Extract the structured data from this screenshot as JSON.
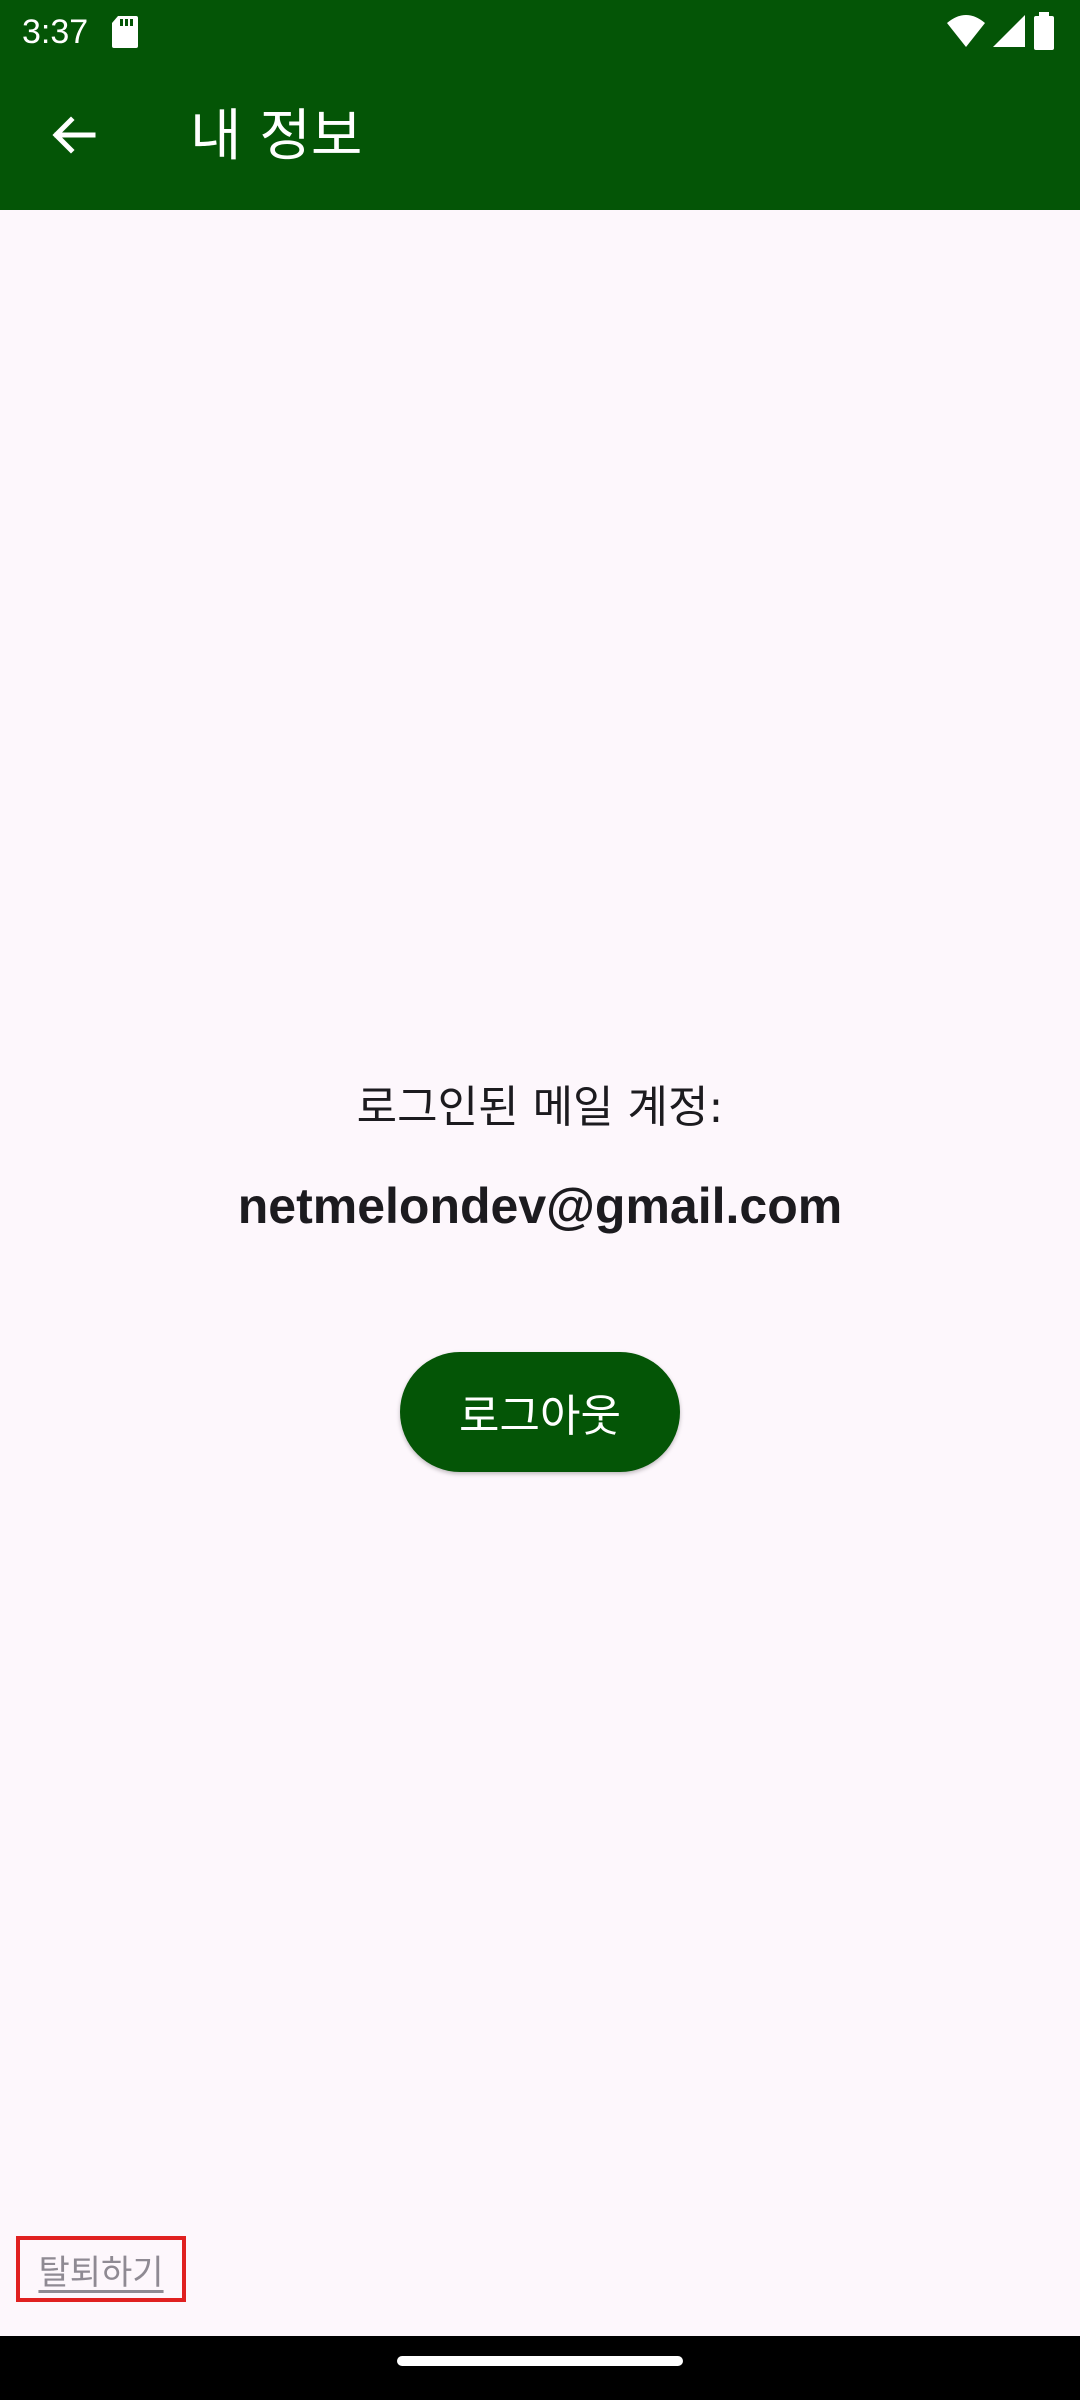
{
  "status_bar": {
    "time": "3:37",
    "icons": [
      "sd-card-icon",
      "wifi-icon",
      "cell-signal-icon",
      "battery-icon"
    ]
  },
  "app_bar": {
    "title": "내 정보",
    "back_icon": "arrow-back-icon"
  },
  "account": {
    "label": "로그인된 메일 계정:",
    "email": "netmelondev@gmail.com"
  },
  "logout_button": {
    "label": "로그아웃"
  },
  "withdraw_link": {
    "label": "탈퇴하기"
  },
  "colors": {
    "primary": "#045506",
    "background": "#fdf7fc",
    "text": "#1c1b1f",
    "muted_link": "#8f8a93",
    "highlight_border": "#e02020"
  }
}
